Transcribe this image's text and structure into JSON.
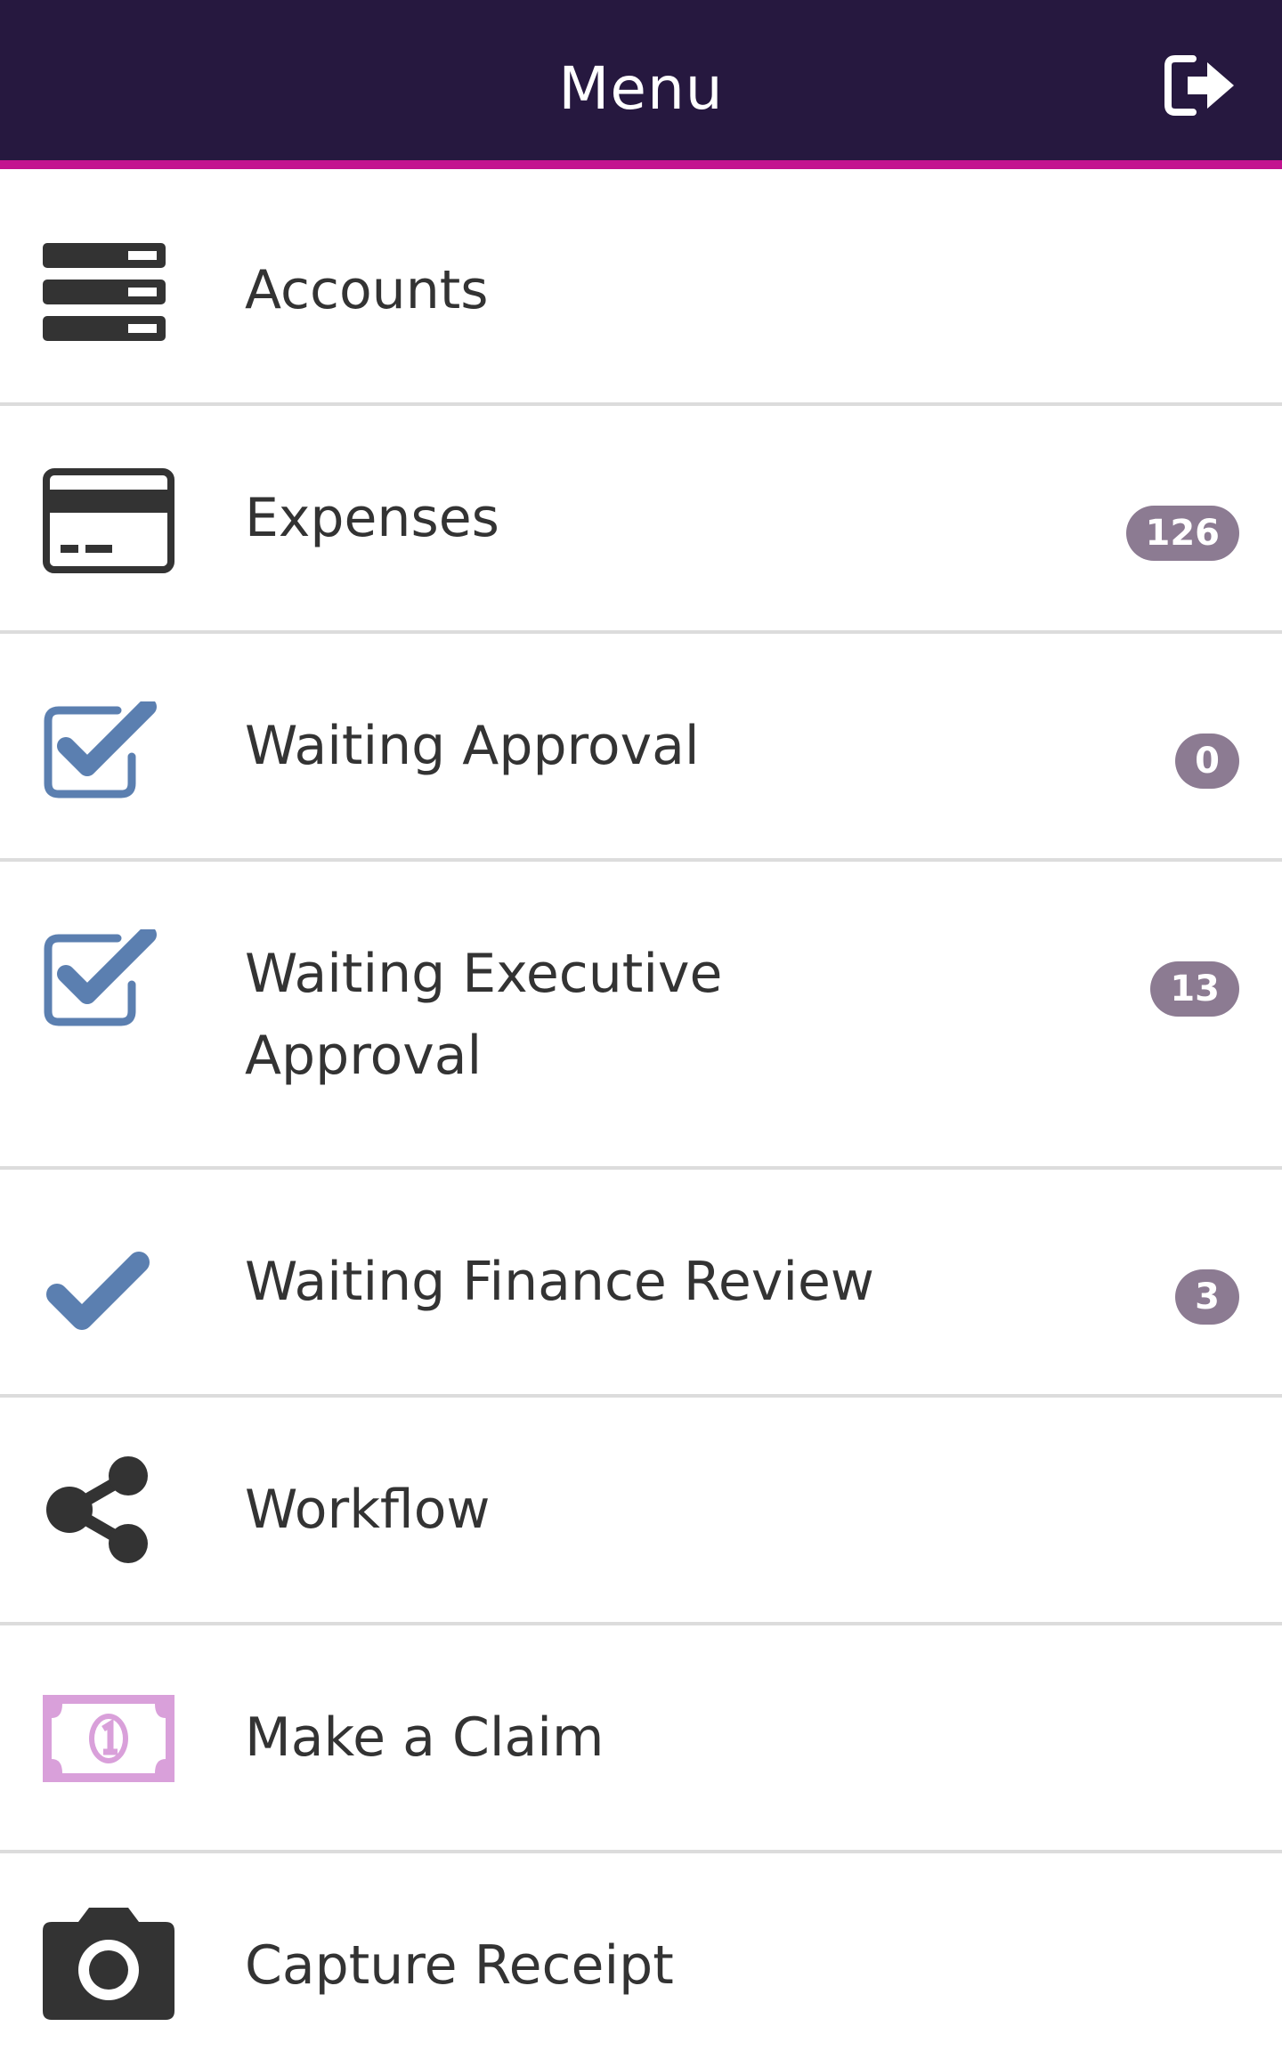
{
  "header": {
    "title": "Menu",
    "logout_icon": "logout-icon"
  },
  "colors": {
    "header_bg": "#26183f",
    "header_accent": "#c3138f",
    "badge_bg": "#8c7b92",
    "check_blue": "#5b7fb0",
    "claim_pink": "#d9a0da",
    "icon_dark": "#333333"
  },
  "menu": {
    "items": [
      {
        "label": "Accounts",
        "icon": "server-stack-icon",
        "badge": null
      },
      {
        "label": "Expenses",
        "icon": "credit-card-icon",
        "badge": "126"
      },
      {
        "label": "Waiting Approval",
        "icon": "checkbox-checked-icon",
        "badge": "0"
      },
      {
        "label": "Waiting Executive Approval",
        "icon": "checkbox-checked-icon",
        "badge": "13"
      },
      {
        "label": "Waiting Finance Review",
        "icon": "checkmark-icon",
        "badge": "3"
      },
      {
        "label": "Workflow",
        "icon": "share-icon",
        "badge": null
      },
      {
        "label": "Make a Claim",
        "icon": "money-bill-icon",
        "badge": null
      },
      {
        "label": "Capture Receipt",
        "icon": "camera-icon",
        "badge": null
      }
    ]
  }
}
